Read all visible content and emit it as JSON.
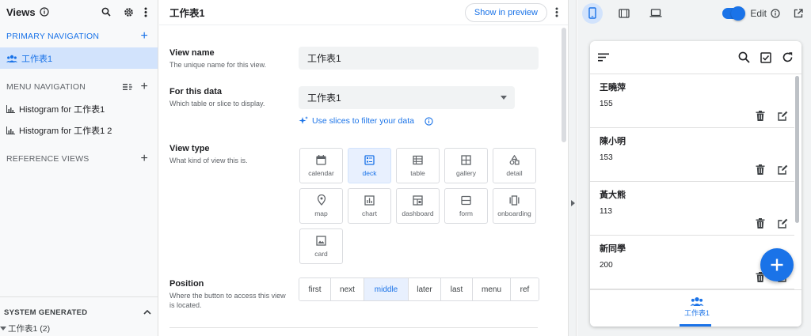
{
  "sidebar": {
    "title": "Views",
    "primary_nav_label": "PRIMARY NAVIGATION",
    "primary_items": [
      {
        "label": "工作表1"
      }
    ],
    "menu_nav_label": "MENU NAVIGATION",
    "menu_items": [
      {
        "label": "Histogram for 工作表1"
      },
      {
        "label": "Histogram for 工作表1 2"
      }
    ],
    "reference_views_label": "REFERENCE VIEWS",
    "system_generated_label": "SYSTEM GENERATED",
    "system_tree_item": "工作表1 (2)"
  },
  "editor": {
    "title": "工作表1",
    "preview_button": "Show in preview",
    "view_name": {
      "label": "View name",
      "desc": "The unique name for this view.",
      "value": "工作表1"
    },
    "for_this_data": {
      "label": "For this data",
      "desc": "Which table or slice to display.",
      "value": "工作表1"
    },
    "slices_link": "Use slices to filter your data",
    "view_type": {
      "label": "View type",
      "desc": "What kind of view this is.",
      "selected": "deck",
      "options": [
        {
          "label": "calendar",
          "icon": "calendar-icon"
        },
        {
          "label": "deck",
          "icon": "deck-icon"
        },
        {
          "label": "table",
          "icon": "table-icon"
        },
        {
          "label": "gallery",
          "icon": "gallery-icon"
        },
        {
          "label": "detail",
          "icon": "detail-icon"
        },
        {
          "label": "map",
          "icon": "map-pin-icon"
        },
        {
          "label": "chart",
          "icon": "chart-icon"
        },
        {
          "label": "dashboard",
          "icon": "dashboard-icon"
        },
        {
          "label": "form",
          "icon": "form-icon"
        },
        {
          "label": "onboarding",
          "icon": "onboarding-icon"
        },
        {
          "label": "card",
          "icon": "card-icon"
        }
      ]
    },
    "position": {
      "label": "Position",
      "desc": "Where the button to access this view is located.",
      "selected": "middle",
      "options": [
        "first",
        "next",
        "middle",
        "later",
        "last",
        "menu",
        "ref"
      ]
    }
  },
  "preview": {
    "edit_label": "Edit",
    "edit_enabled": true,
    "records": [
      {
        "name": "王曉萍",
        "value": "155"
      },
      {
        "name": "陳小明",
        "value": "153"
      },
      {
        "name": "黃大熊",
        "value": "113"
      },
      {
        "name": "新同學",
        "value": "200"
      }
    ],
    "bottom_tab_label": "工作表1"
  },
  "colors": {
    "accent": "#1a73e8",
    "selected_bg": "#d2e3fc"
  }
}
